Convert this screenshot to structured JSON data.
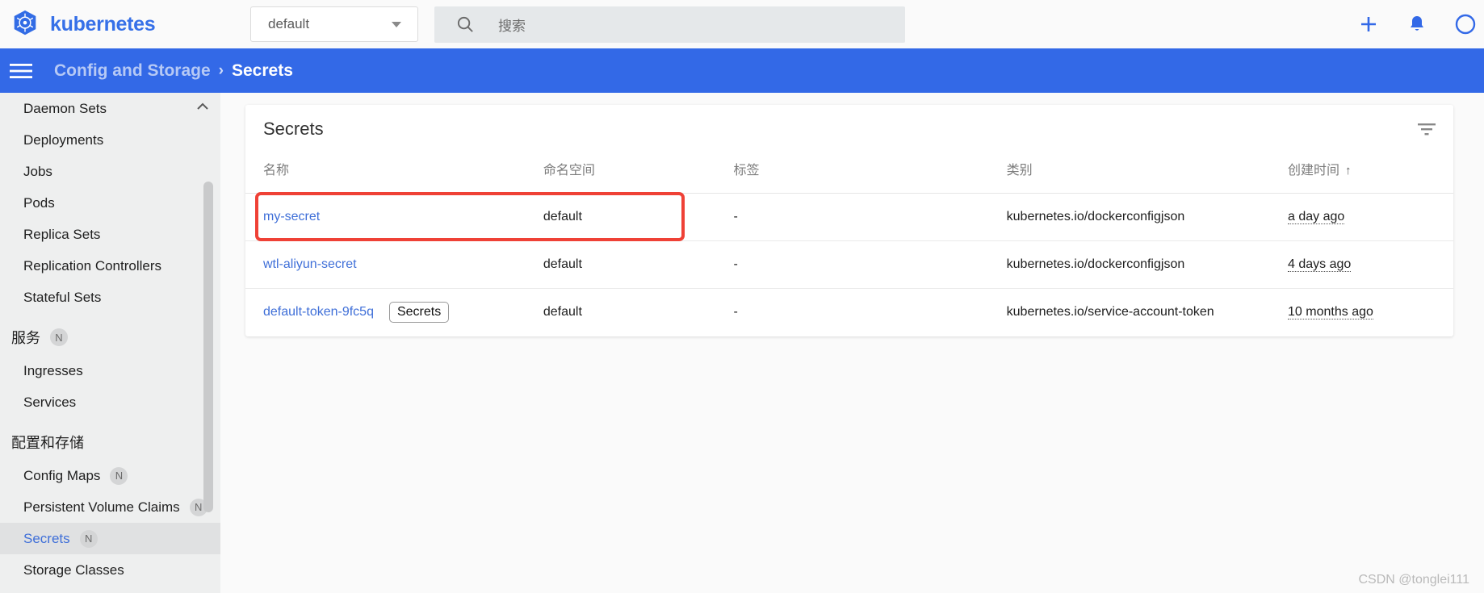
{
  "topbar": {
    "brand": "kubernetes",
    "logo_icon": "kubernetes-wheel-logo",
    "namespace": {
      "value": "default",
      "caret_icon": "chevron-down-icon"
    },
    "search": {
      "placeholder": "搜索",
      "icon": "search-icon"
    },
    "actions": [
      {
        "name": "create-button",
        "icon": "plus-icon"
      },
      {
        "name": "notifications-button",
        "icon": "bell-icon"
      },
      {
        "name": "help-button",
        "icon": "help-circle-icon"
      }
    ],
    "accent_color": "#3369e7"
  },
  "breadcrumb": {
    "menu_icon": "hamburger-menu-icon",
    "parent": "Config and Storage",
    "separator": "›",
    "current": "Secrets",
    "bar_color": "#3369e7"
  },
  "sidebar": {
    "collapse_icon": "chevron-up-icon",
    "items": [
      {
        "label": "Daemon Sets",
        "type": "item",
        "active": false,
        "badge": ""
      },
      {
        "label": "Deployments",
        "type": "item",
        "active": false,
        "badge": ""
      },
      {
        "label": "Jobs",
        "type": "item",
        "active": false,
        "badge": ""
      },
      {
        "label": "Pods",
        "type": "item",
        "active": false,
        "badge": ""
      },
      {
        "label": "Replica Sets",
        "type": "item",
        "active": false,
        "badge": ""
      },
      {
        "label": "Replication Controllers",
        "type": "item",
        "active": false,
        "badge": ""
      },
      {
        "label": "Stateful Sets",
        "type": "item",
        "active": false,
        "badge": ""
      },
      {
        "label": "服务",
        "type": "group",
        "active": false,
        "badge": "N"
      },
      {
        "label": "Ingresses",
        "type": "item",
        "active": false,
        "badge": ""
      },
      {
        "label": "Services",
        "type": "item",
        "active": false,
        "badge": ""
      },
      {
        "label": "配置和存储",
        "type": "group",
        "active": false,
        "badge": ""
      },
      {
        "label": "Config Maps",
        "type": "item",
        "active": false,
        "badge": "N"
      },
      {
        "label": "Persistent Volume Claims",
        "type": "item",
        "active": false,
        "badge": "N"
      },
      {
        "label": "Secrets",
        "type": "item",
        "active": true,
        "badge": "N"
      },
      {
        "label": "Storage Classes",
        "type": "item",
        "active": false,
        "badge": ""
      }
    ]
  },
  "main": {
    "card_title": "Secrets",
    "filter_icon": "filter-funnel-icon",
    "columns": [
      {
        "label": "名称",
        "sorted": false,
        "sort_arrow": ""
      },
      {
        "label": "命名空间",
        "sorted": false,
        "sort_arrow": ""
      },
      {
        "label": "标签",
        "sorted": false,
        "sort_arrow": ""
      },
      {
        "label": "类别",
        "sorted": false,
        "sort_arrow": ""
      },
      {
        "label": "创建时间",
        "sorted": true,
        "sort_arrow": "↑"
      }
    ],
    "rows": [
      {
        "name": "my-secret",
        "tooltip": "",
        "namespace": "default",
        "labels": "-",
        "type": "kubernetes.io/dockerconfigjson",
        "created": "a day ago",
        "highlighted": true
      },
      {
        "name": "wtl-aliyun-secret",
        "tooltip": "",
        "namespace": "default",
        "labels": "-",
        "type": "kubernetes.io/dockerconfigjson",
        "created": "4 days ago",
        "highlighted": false
      },
      {
        "name": "default-token-9fc5q",
        "tooltip": "Secrets",
        "namespace": "default",
        "labels": "-",
        "type": "kubernetes.io/service-account-token",
        "created": "10 months ago",
        "highlighted": false
      }
    ],
    "annotation_color": "#ef4136"
  },
  "watermark": "CSDN @tonglei111"
}
